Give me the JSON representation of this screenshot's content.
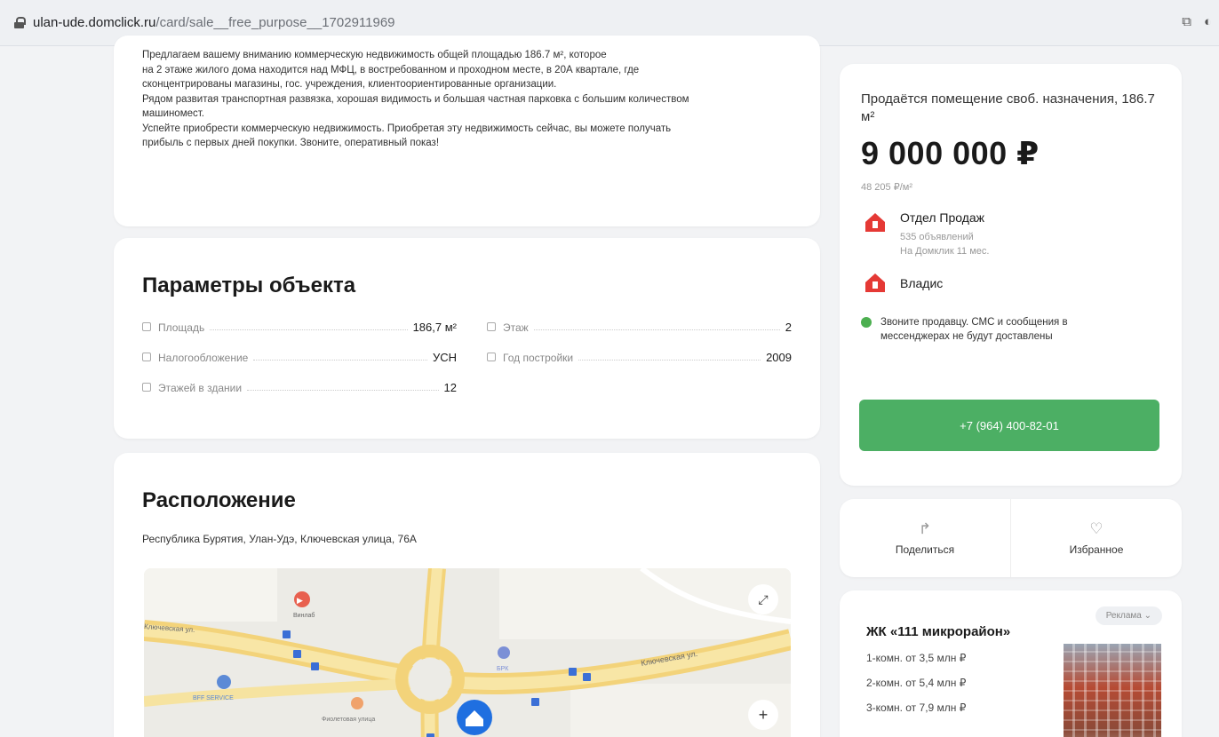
{
  "browser": {
    "url_host": "ulan-ude.domclick.ru",
    "url_path": "/card/sale__free_purpose__1702911969"
  },
  "description": {
    "lines": [
      "Предлагаем вашему вниманию коммерческую недвижимость общей площадью 186.7 м², которое",
      "на 2 этаже жилого дома находится над МФЦ, в востребованном и проходном месте, в 20А квартале, где",
      "сконцентрированы магазины, гос. учреждения, клиентоориентированные организации.",
      "Рядом развитая транспортная развязка, хорошая видимость и большая частная парковка с большим количеством",
      "машиномест.",
      "Успейте приобрести коммерческую недвижимость. Приобретая эту недвижимость сейчас, вы можете получать",
      "прибыль с первых дней покупки. Звоните, оперативный показ!"
    ]
  },
  "params": {
    "title": "Параметры объекта",
    "rows": [
      {
        "label": "Площадь",
        "value": "186,7 м²"
      },
      {
        "label": "Этаж",
        "value": "2"
      },
      {
        "label": "Налогообложение",
        "value": "УСН"
      },
      {
        "label": "Год постройки",
        "value": "2009"
      },
      {
        "label": "Этажей в здании",
        "value": "12"
      }
    ]
  },
  "location": {
    "title": "Расположение",
    "address": "Республика Бурятия, Улан-Удэ, Ключевская улица, 76А",
    "map_labels": {
      "street1": "Ключевская ул.",
      "street2": "Ключевская ул.",
      "poi1": "Винлаб",
      "poi2": "BFF SERVICE",
      "poi3": "БРК",
      "poi4": "Фиолетовая улица"
    }
  },
  "listing": {
    "title": "Продаётся помещение своб. назначения, 186.7 м²",
    "price": "9 000 000 ₽",
    "price_per_m2": "48 205 ₽/м²",
    "agency": {
      "name": "Отдел Продаж",
      "count": "535 объявлений",
      "since": "На Домклик 11 мес.",
      "agent": "Владис"
    },
    "note": "Звоните продавцу. СМС и сообщения в мессенджерах не будут доставлены",
    "phone_button": "+7 (964) 400-82-01"
  },
  "actions": {
    "share": "Поделиться",
    "favorite": "Избранное"
  },
  "ad": {
    "tag": "Реклама",
    "title": "ЖК «111 микрорайон»",
    "rooms": [
      "1-комн. от 3,5 млн ₽",
      "2-комн. от 5,4 млн ₽",
      "3-комн. от 7,9 млн ₽"
    ]
  },
  "colors": {
    "accent_green": "#4caf64",
    "brand_red": "#e53935"
  }
}
